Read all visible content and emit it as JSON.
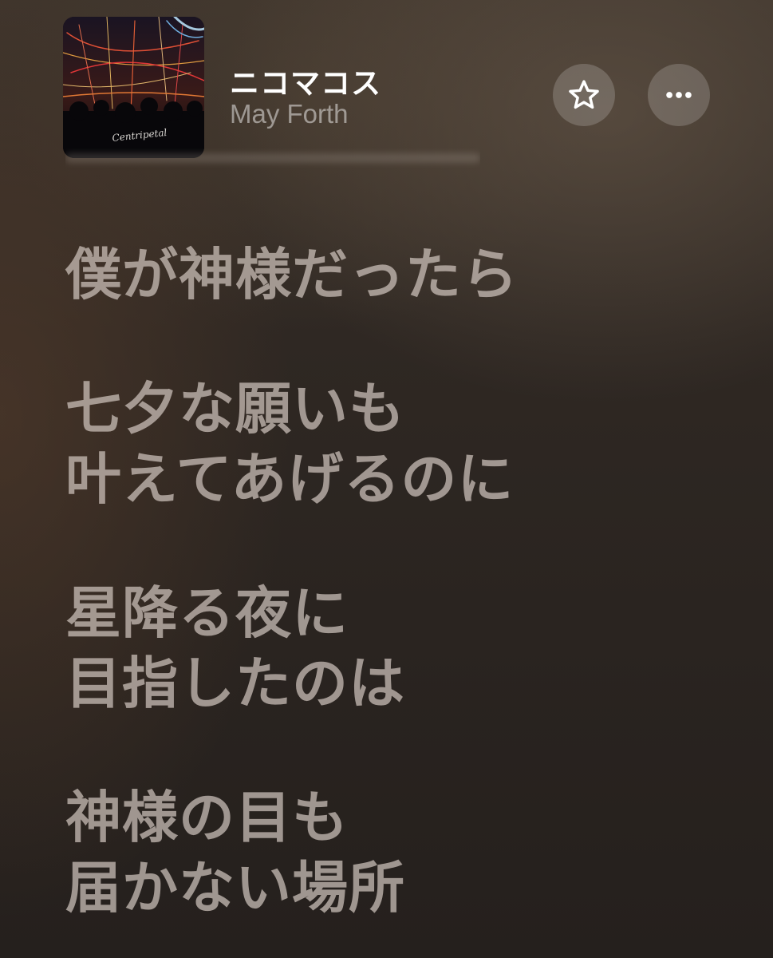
{
  "now_playing": {
    "title": "ニコマコス",
    "artist": "May Forth",
    "artwork_text": "Centripetal"
  },
  "actions": {
    "favorite_icon": "star-outline-icon",
    "more_icon": "ellipsis-icon"
  },
  "lyrics": {
    "stanzas": [
      [
        "僕が神様だったら"
      ],
      [
        "七夕な願いも",
        "叶えてあげるのに"
      ],
      [
        "星降る夜に",
        "目指したのは"
      ],
      [
        "神様の目も",
        "届かない場所"
      ]
    ]
  },
  "colors": {
    "title": "#ffffff",
    "artist": "#8f8781",
    "lyric_text": "#c2b8b0",
    "button_bg": "#5a524c"
  }
}
